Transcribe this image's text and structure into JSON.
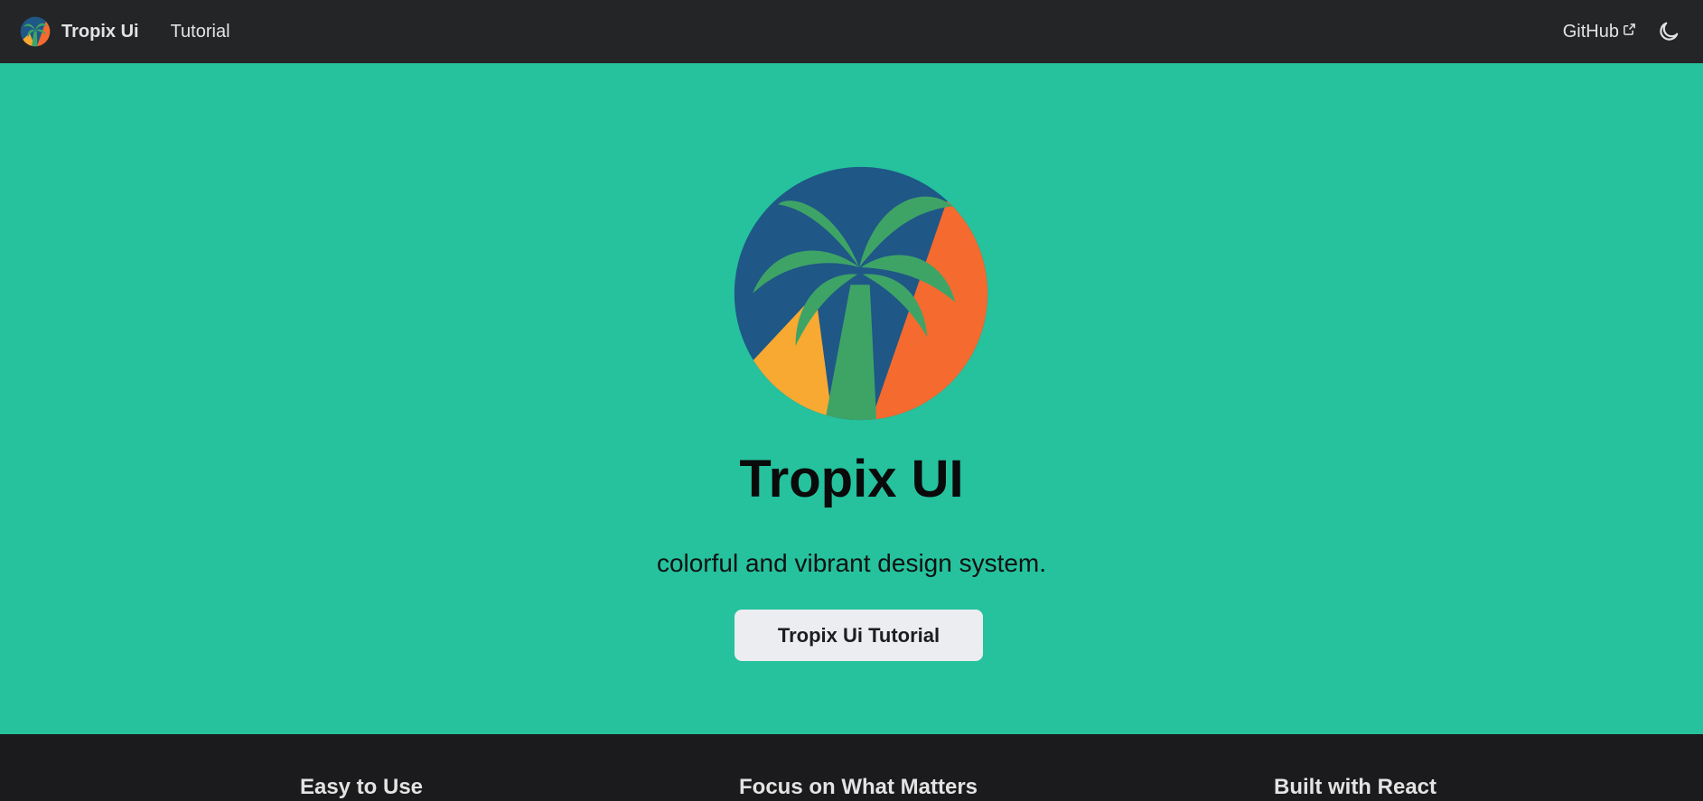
{
  "navbar": {
    "brand_title": "Tropix Ui",
    "links": [
      {
        "label": "Tutorial"
      }
    ],
    "github_label": "GitHub",
    "theme_toggle_icon": "moon-icon",
    "external_link_icon": "external-link-icon"
  },
  "hero": {
    "logo_icon": "palm-tree-logo",
    "title": "Tropix UI",
    "subtitle": "colorful and vibrant design system.",
    "button_label": "Tropix Ui Tutorial"
  },
  "features": [
    {
      "title": "Easy to Use"
    },
    {
      "title": "Focus on What Matters"
    },
    {
      "title": "Built with React"
    }
  ],
  "colors": {
    "navbar_bg": "#242526",
    "hero_bg": "#25c29d",
    "footer_bg": "#1b1b1d",
    "logo_blue": "#1f5786",
    "logo_orange": "#f56a2f",
    "logo_yellow": "#f8a932",
    "logo_green": "#3ea466"
  }
}
